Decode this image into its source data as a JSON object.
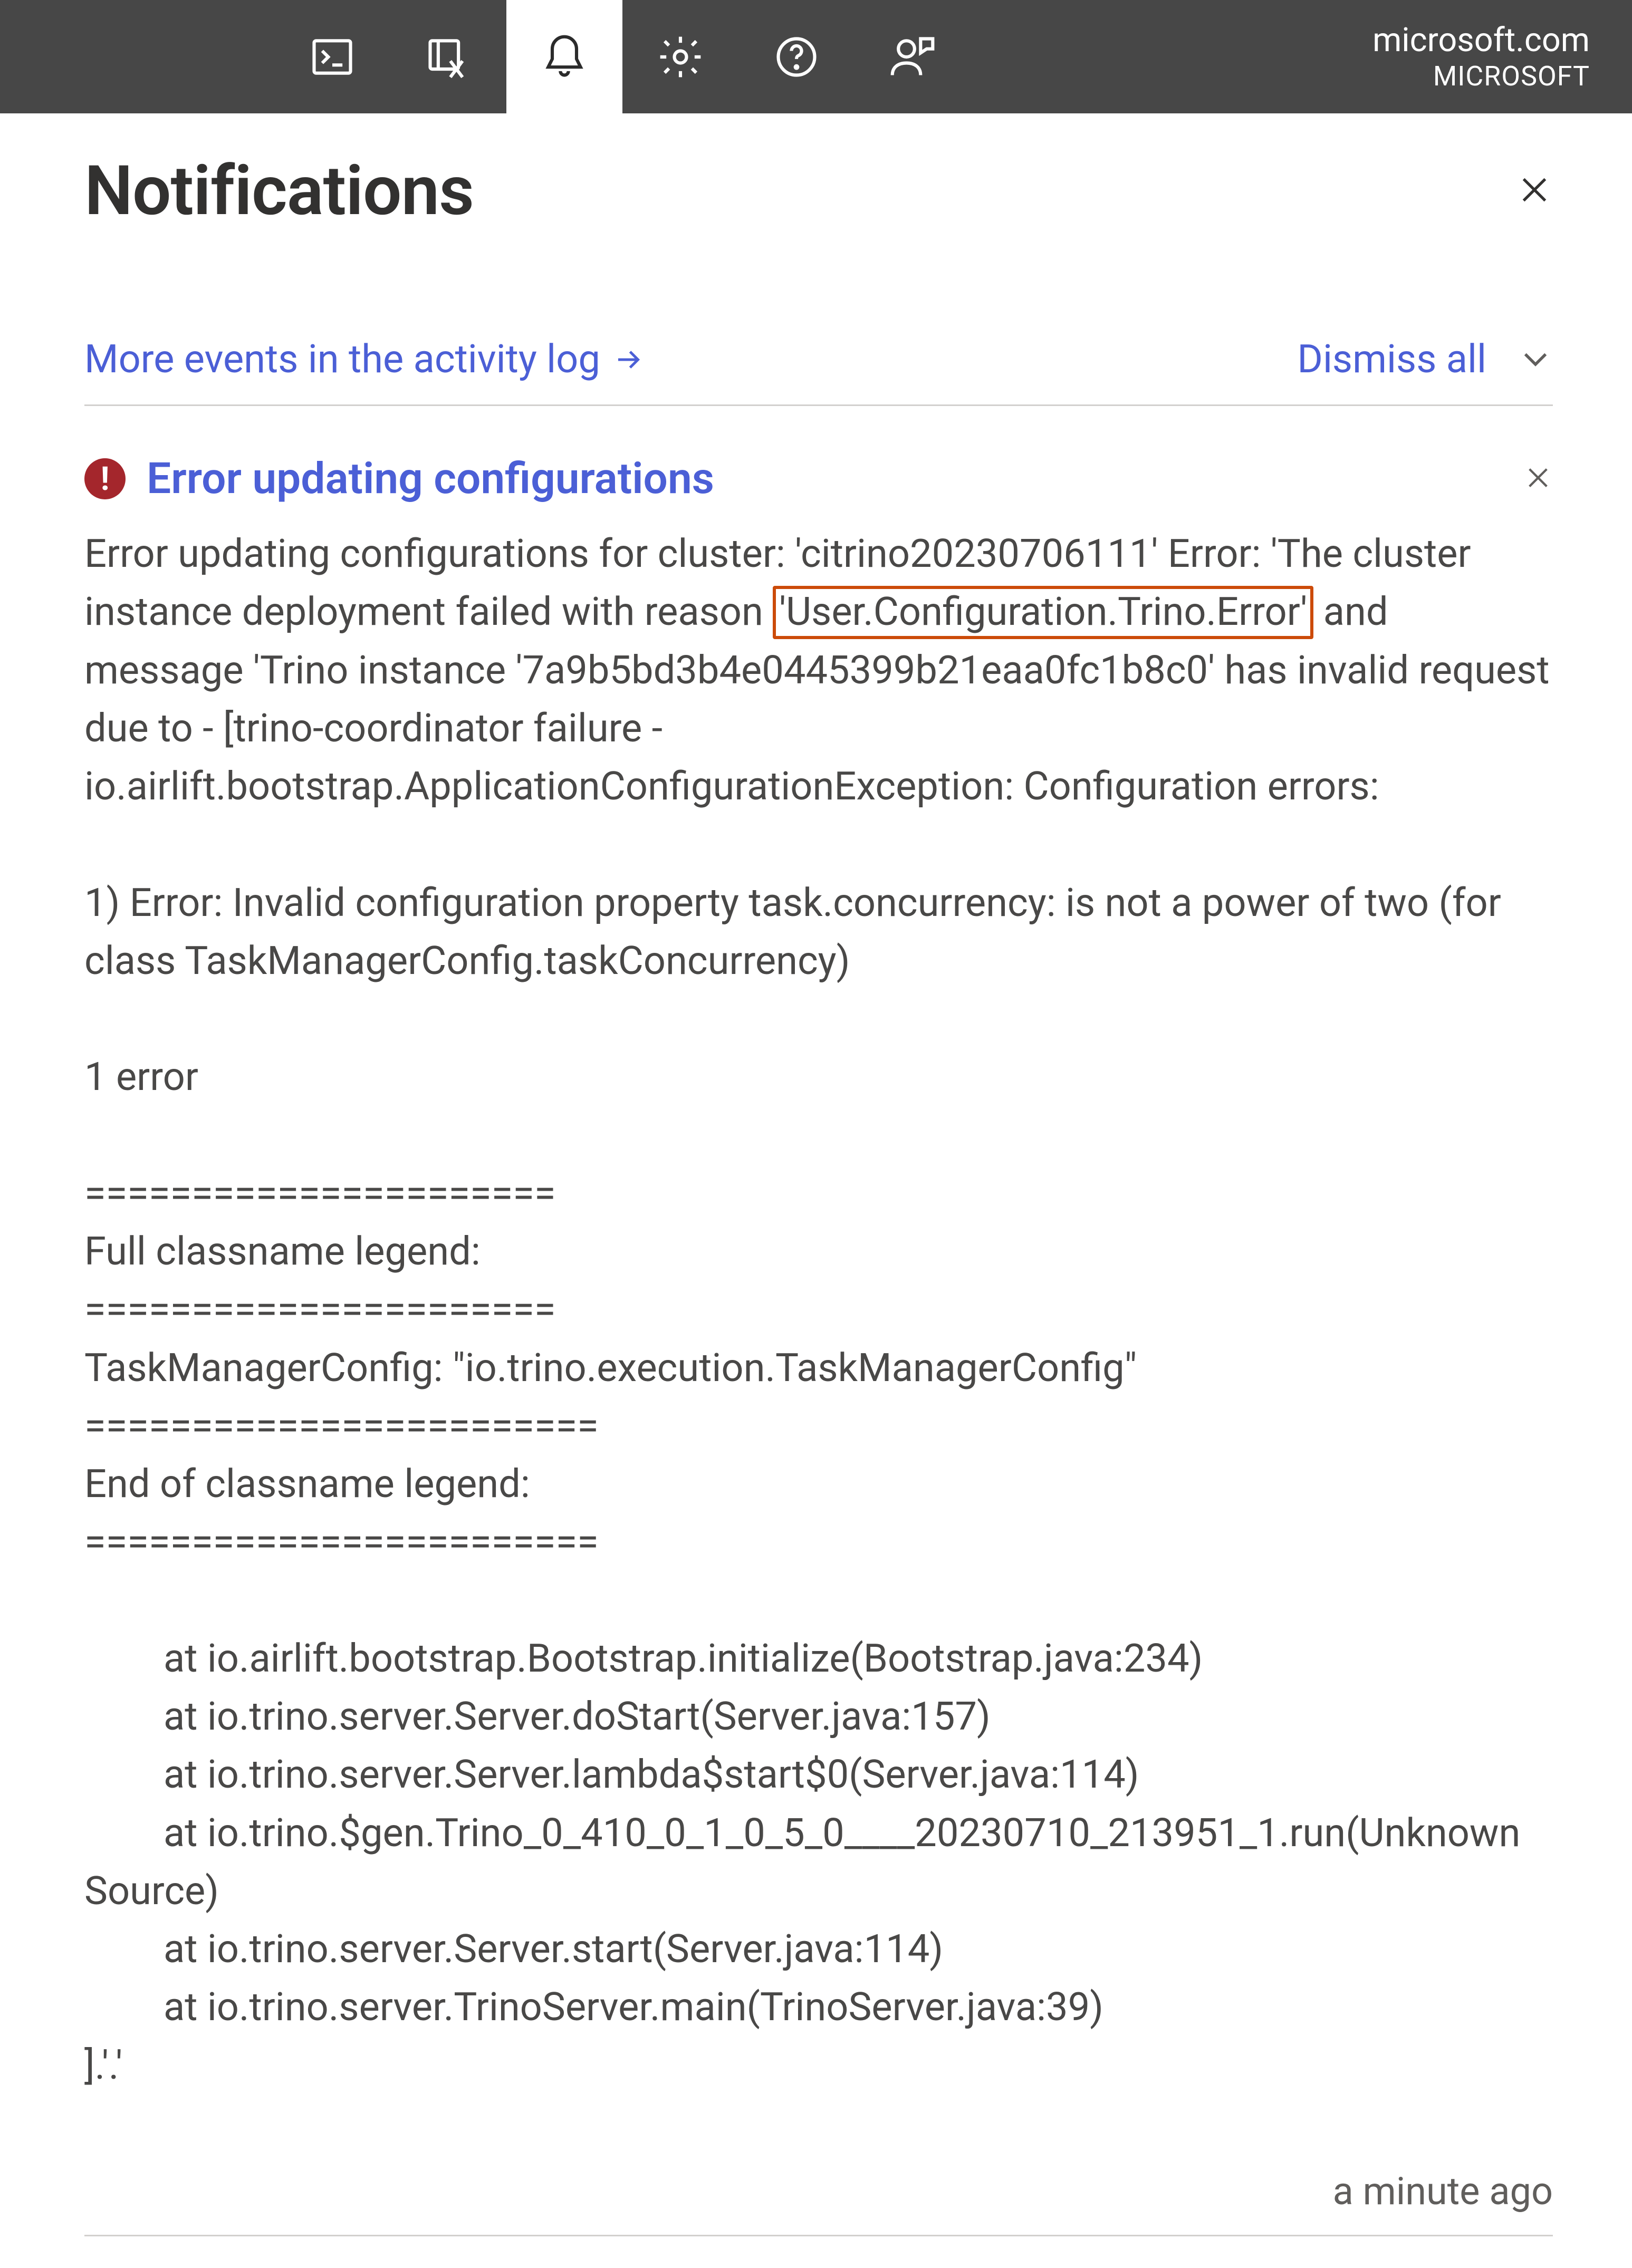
{
  "topbar": {
    "tenant_domain": "microsoft.com",
    "tenant_name": "MICROSOFT"
  },
  "panel": {
    "title": "Notifications",
    "activity_log_link": "More events in the activity log",
    "dismiss_all": "Dismiss all"
  },
  "notification": {
    "title": "Error updating configurations",
    "timestamp": "a minute ago",
    "body_pre": "Error updating configurations for cluster: 'citrino20230706111' Error: 'The cluster instance deployment failed with reason ",
    "highlighted": "'User.Configuration.Trino.Error'",
    "body_post_1": " and message 'Trino instance '7a9b5bd3b4e0445399b21eaa0fc1b8c0' has invalid request due to - [trino-coordinator failure - io.airlift.bootstrap.ApplicationConfigurationException: Configuration errors:\n\n1) Error: Invalid configuration property task.concurrency: is not a power of two (for class TaskManagerConfig.taskConcurrency)\n\n1 error\n\n======================\nFull classname legend:\n======================\nTaskManagerConfig: \"io.trino.execution.TaskManagerConfig\"\n========================\nEnd of classname legend:\n========================\n",
    "stack_1": "at io.airlift.bootstrap.Bootstrap.initialize(Bootstrap.java:234)",
    "stack_2": "at io.trino.server.Server.doStart(Server.java:157)",
    "stack_3": "at io.trino.server.Server.lambda$start$0(Server.java:114)",
    "stack_4": "at io.trino.$gen.Trino_0_410_0_1_0_5_0____20230710_213951_1.run(Unknown",
    "stack_4b": "Source)",
    "stack_5": "at io.trino.server.Server.start(Server.java:114)",
    "stack_6": "at io.trino.server.TrinoServer.main(TrinoServer.java:39)",
    "body_tail": "].'.'"
  }
}
